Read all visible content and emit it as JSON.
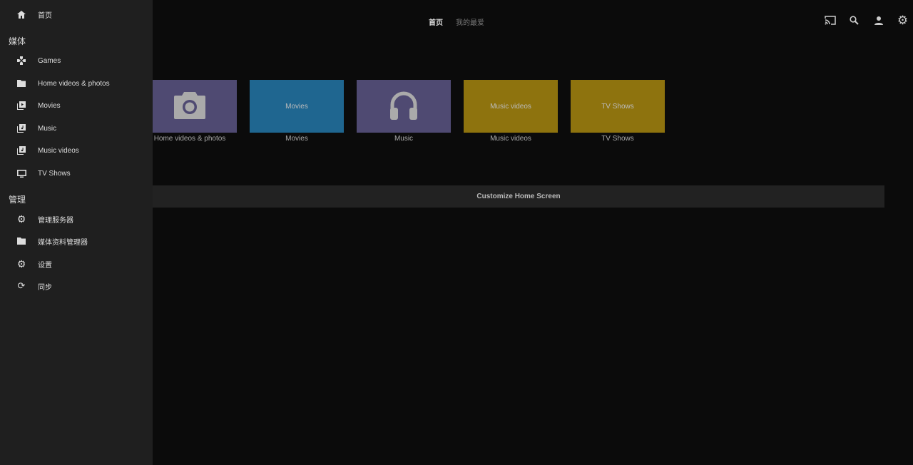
{
  "sidebar": {
    "home": "首页",
    "media_header": "媒体",
    "media": [
      {
        "label": "Games",
        "icon": "gamepad-icon"
      },
      {
        "label": "Home videos & photos",
        "icon": "folder-icon"
      },
      {
        "label": "Movies",
        "icon": "video-library-icon"
      },
      {
        "label": "Music",
        "icon": "music-library-icon"
      },
      {
        "label": "Music videos",
        "icon": "music-library-icon"
      },
      {
        "label": "TV Shows",
        "icon": "tv-icon"
      }
    ],
    "admin_header": "管理",
    "admin": [
      {
        "label": "管理服务器",
        "icon": "gear-icon"
      },
      {
        "label": "媒体资料管理器",
        "icon": "folder-icon"
      },
      {
        "label": "设置",
        "icon": "gear-icon"
      },
      {
        "label": "同步",
        "icon": "sync-icon"
      }
    ]
  },
  "header": {
    "tabs": [
      "首页",
      "我的最爱"
    ]
  },
  "libraries": [
    {
      "label": "Home videos & photos",
      "tile_text": "",
      "color": "#4f4a72"
    },
    {
      "label": "Movies",
      "tile_text": "Movies",
      "color": "#1f6690"
    },
    {
      "label": "Music",
      "tile_text": "",
      "color": "#4f4a72"
    },
    {
      "label": "Music videos",
      "tile_text": "Music videos",
      "color": "#8e730e"
    },
    {
      "label": "TV Shows",
      "tile_text": "TV Shows",
      "color": "#8e730e"
    }
  ],
  "customize_label": "Customize Home Screen"
}
